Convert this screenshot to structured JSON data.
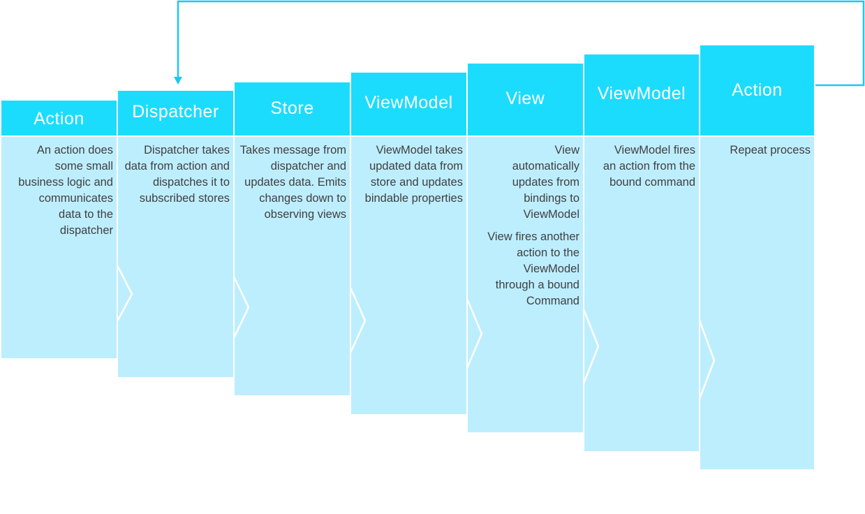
{
  "diagram": {
    "colors": {
      "header": "#1cdcfe",
      "body": "#bdeefe",
      "arrow": "#1cc8f0",
      "text": "#404040"
    },
    "steps": [
      {
        "title": "Action",
        "paragraphs": [
          "An action does some small business logic and communicates data to the dispatcher"
        ]
      },
      {
        "title": "Dispatcher",
        "paragraphs": [
          "Dispatcher takes data from action and dispatches it to subscribed stores"
        ]
      },
      {
        "title": "Store",
        "paragraphs": [
          "Takes message from dispatcher and updates data. Emits changes down to observing views"
        ]
      },
      {
        "title": "ViewModel",
        "paragraphs": [
          "ViewModel takes updated data from store and updates bindable properties"
        ]
      },
      {
        "title": "View",
        "paragraphs": [
          "View automatically updates from bindings to ViewModel",
          "View fires another action to the ViewModel through a bound Command"
        ]
      },
      {
        "title": "ViewModel",
        "paragraphs": [
          "ViewModel fires an action from the bound command"
        ]
      },
      {
        "title": "Action",
        "paragraphs": [
          "Repeat process"
        ]
      }
    ],
    "loop_arrow": {
      "from": "Action",
      "to": "Dispatcher",
      "icon": "loop-back-arrow-icon"
    }
  }
}
